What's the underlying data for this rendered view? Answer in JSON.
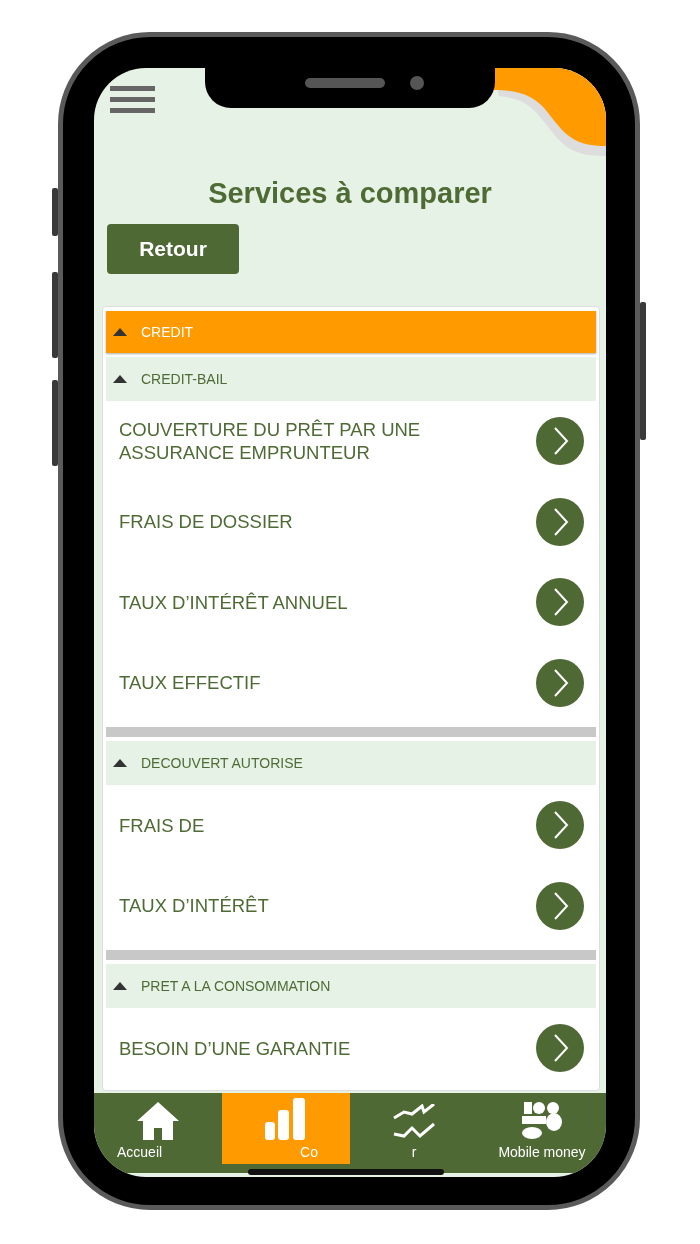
{
  "header": {
    "title": "Services à comparer",
    "back_button": "Retour"
  },
  "sections": [
    {
      "label": "CREDIT",
      "expanded": true,
      "groups": [
        {
          "label": "CREDIT-BAIL",
          "expanded": true,
          "items": [
            "COUVERTURE DU PRÊT PAR UNE ASSURANCE EMPRUNTEUR",
            "FRAIS DE DOSSIER",
            "TAUX D’INTÉRÊT ANNUEL",
            "TAUX EFFECTIF"
          ]
        },
        {
          "label": "DECOUVERT AUTORISE",
          "expanded": true,
          "items": [
            "FRAIS DE",
            "TAUX D’INTÉRÊT"
          ]
        },
        {
          "label": "PRET A LA CONSOMMATION",
          "expanded": true,
          "items": [
            "BESOIN D’UNE GARANTIE"
          ]
        }
      ]
    }
  ],
  "tab_bar": [
    {
      "label": "Accueil",
      "selected": false
    },
    {
      "label": "Co",
      "selected": true
    },
    {
      "label": "r",
      "selected": false
    },
    {
      "label": "Mobile money",
      "selected": false
    }
  ]
}
